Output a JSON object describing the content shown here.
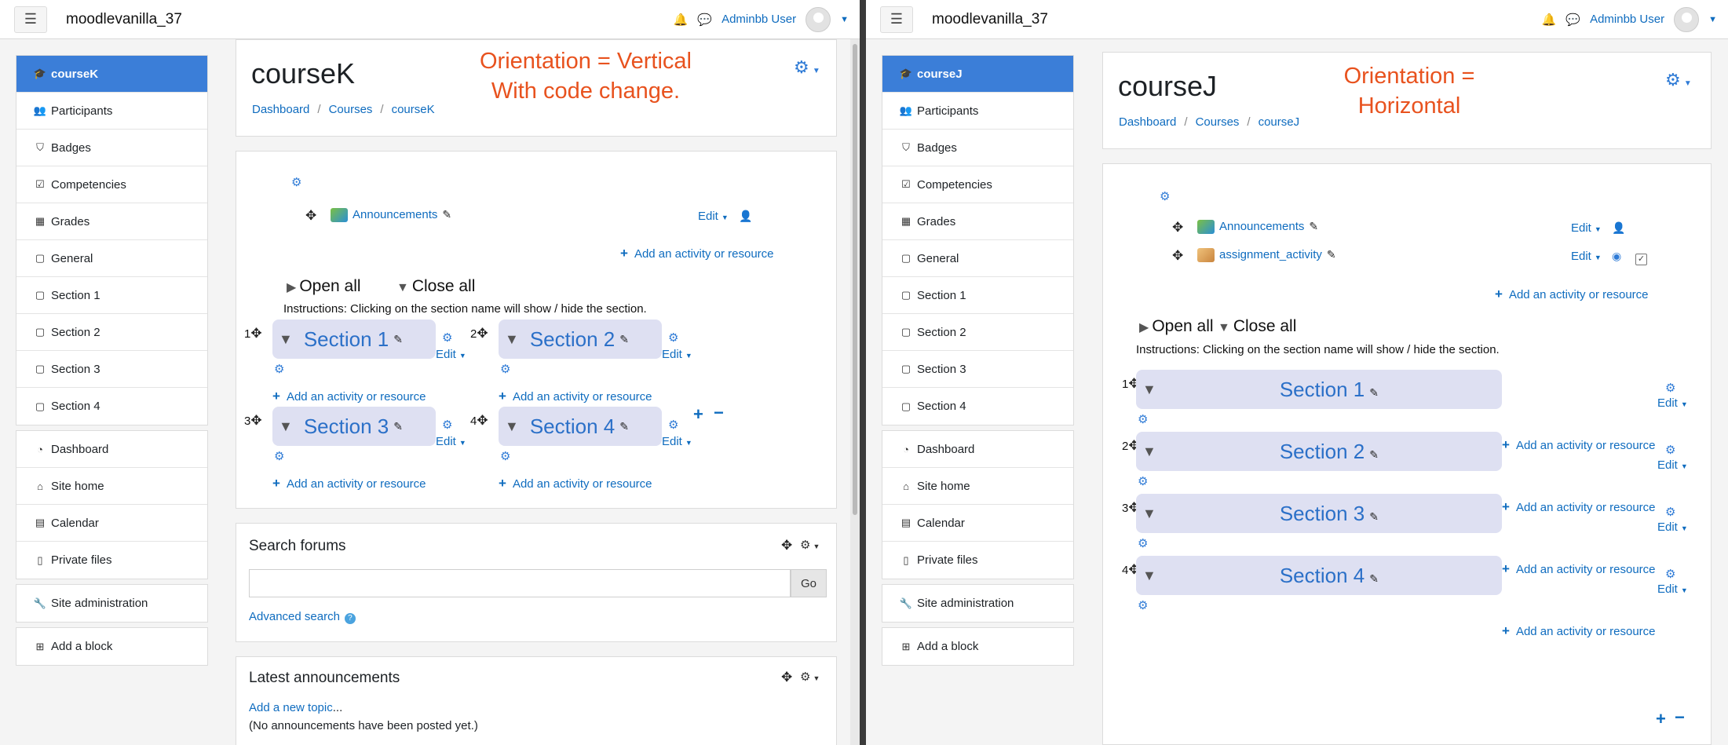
{
  "left": {
    "site_name": "moodlevanilla_37",
    "user": "Adminbb User",
    "nav_main": [
      {
        "label": "courseK",
        "icon": "graduation-cap-icon",
        "active": true
      },
      {
        "label": "Participants",
        "icon": "users-icon"
      },
      {
        "label": "Badges",
        "icon": "shield-icon"
      },
      {
        "label": "Competencies",
        "icon": "check-square-icon"
      },
      {
        "label": "Grades",
        "icon": "table-icon"
      },
      {
        "label": "General",
        "icon": "folder-icon"
      },
      {
        "label": "Section 1",
        "icon": "folder-icon"
      },
      {
        "label": "Section 2",
        "icon": "folder-icon"
      },
      {
        "label": "Section 3",
        "icon": "folder-icon"
      },
      {
        "label": "Section 4",
        "icon": "folder-icon"
      }
    ],
    "nav_site": [
      {
        "label": "Dashboard",
        "icon": "dashboard-icon"
      },
      {
        "label": "Site home",
        "icon": "home-icon"
      },
      {
        "label": "Calendar",
        "icon": "calendar-icon"
      },
      {
        "label": "Private files",
        "icon": "file-icon"
      }
    ],
    "nav_admin": {
      "label": "Site administration",
      "icon": "wrench-icon"
    },
    "nav_block": {
      "label": "Add a block",
      "icon": "plus-square-icon"
    },
    "course_title": "courseK",
    "breadcrumb": [
      "Dashboard",
      "Courses",
      "courseK"
    ],
    "annotation_line1": "Orientation = Vertical",
    "annotation_line2": "With code change.",
    "announcement": "Announcements",
    "edit": "Edit",
    "add_activity": "Add an activity or resource",
    "open_all": "Open all",
    "close_all": "Close all",
    "instructions": "Instructions: Clicking on the section name will show / hide the section.",
    "sections": [
      {
        "num": "1",
        "name": "Section 1"
      },
      {
        "num": "2",
        "name": "Section 2"
      },
      {
        "num": "3",
        "name": "Section 3"
      },
      {
        "num": "4",
        "name": "Section 4"
      }
    ],
    "search_forums": "Search forums",
    "go": "Go",
    "advanced_search": "Advanced search",
    "latest_announcements": "Latest announcements",
    "add_new_topic": "Add a new topic",
    "add_new_topic_suffix": "...",
    "no_announcements": "(No announcements have been posted yet.)"
  },
  "right": {
    "site_name": "moodlevanilla_37",
    "user": "Adminbb User",
    "nav_main": [
      {
        "label": "courseJ",
        "icon": "graduation-cap-icon",
        "active": true
      },
      {
        "label": "Participants",
        "icon": "users-icon"
      },
      {
        "label": "Badges",
        "icon": "shield-icon"
      },
      {
        "label": "Competencies",
        "icon": "check-square-icon"
      },
      {
        "label": "Grades",
        "icon": "table-icon"
      },
      {
        "label": "General",
        "icon": "folder-icon"
      },
      {
        "label": "Section 1",
        "icon": "folder-icon"
      },
      {
        "label": "Section 2",
        "icon": "folder-icon"
      },
      {
        "label": "Section 3",
        "icon": "folder-icon"
      },
      {
        "label": "Section 4",
        "icon": "folder-icon"
      }
    ],
    "nav_site": [
      {
        "label": "Dashboard",
        "icon": "dashboard-icon"
      },
      {
        "label": "Site home",
        "icon": "home-icon"
      },
      {
        "label": "Calendar",
        "icon": "calendar-icon"
      },
      {
        "label": "Private files",
        "icon": "file-icon"
      }
    ],
    "nav_admin": {
      "label": "Site administration",
      "icon": "wrench-icon"
    },
    "nav_block": {
      "label": "Add a block",
      "icon": "plus-square-icon"
    },
    "course_title": "courseJ",
    "breadcrumb": [
      "Dashboard",
      "Courses",
      "courseJ"
    ],
    "annotation_line1": "Orientation =",
    "annotation_line2": "Horizontal",
    "announcement": "Announcements",
    "assignment": "assignment_activity",
    "edit": "Edit",
    "add_activity": "Add an activity or resource",
    "open_all": "Open all",
    "close_all": "Close all",
    "instructions": "Instructions: Clicking on the section name will show / hide the section.",
    "sections": [
      {
        "num": "1",
        "name": "Section 1"
      },
      {
        "num": "2",
        "name": "Section 2"
      },
      {
        "num": "3",
        "name": "Section 3"
      },
      {
        "num": "4",
        "name": "Section 4"
      }
    ]
  },
  "colors": {
    "accent": "#0f6cbf",
    "active_nav": "#3b7ed8",
    "annotation": "#e8521e",
    "section_bg": "#dee0f2"
  }
}
